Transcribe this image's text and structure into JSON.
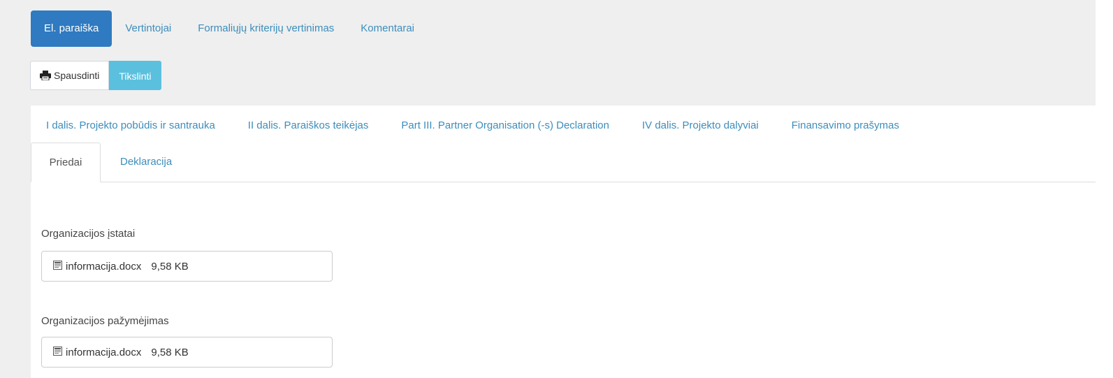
{
  "topnav": {
    "items": [
      {
        "label": "El. paraiška",
        "active": true
      },
      {
        "label": "Vertintojai"
      },
      {
        "label": "Formaliųjų kriterijų vertinimas"
      },
      {
        "label": "Komentarai"
      }
    ]
  },
  "actions": {
    "print_label": "Spausdinti",
    "print_icon": "printer-icon",
    "clarify_label": "Tikslinti"
  },
  "tabs": {
    "row1": [
      "I dalis. Projekto pobūdis ir santrauka",
      "II dalis. Paraiškos teikėjas",
      "Part III. Partner Organisation (-s) Declaration",
      "IV dalis. Projekto dalyviai",
      "Finansavimo prašymas"
    ],
    "row2": [
      {
        "label": "Priedai",
        "active": true
      },
      {
        "label": "Deklaracija"
      }
    ]
  },
  "attachments": [
    {
      "label": "Organizacijos įstatai",
      "file_name": "informacija.docx",
      "file_size": "9,58 KB",
      "icon": "word-document-icon"
    },
    {
      "label": "Organizacijos pažymėjimas",
      "file_name": "informacija.docx",
      "file_size": "9,58 KB",
      "icon": "word-document-icon"
    }
  ],
  "colors": {
    "primary": "#2f7ac0",
    "link": "#3c8dbc",
    "info": "#5bc0de",
    "background": "#efefef"
  }
}
